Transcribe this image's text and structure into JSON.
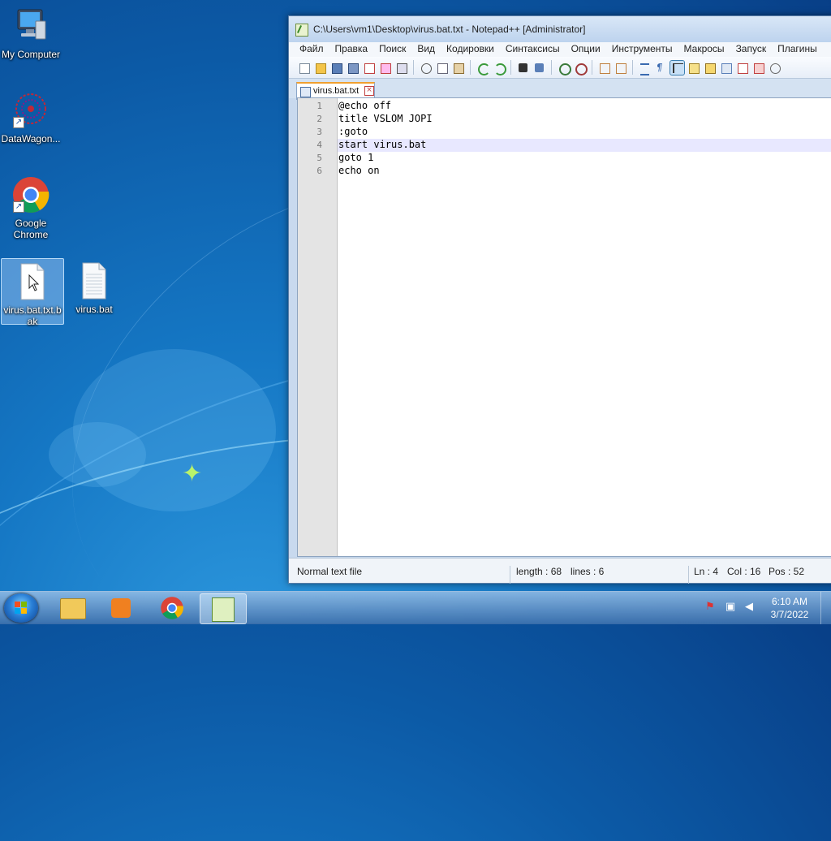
{
  "desktop": {
    "icons": [
      {
        "label": "My Computer",
        "icon": "computer-icon"
      },
      {
        "label": "DataWagon...",
        "icon": "datawagon-icon",
        "shortcut": true
      },
      {
        "label": "Google Chrome",
        "icon": "chrome-icon",
        "shortcut": true
      },
      {
        "label": "virus.bat.txt.bak",
        "icon": "text-file-icon",
        "selected": true
      },
      {
        "label": "virus.bat",
        "icon": "batch-file-icon"
      }
    ]
  },
  "window": {
    "title": "C:\\Users\\vm1\\Desktop\\virus.bat.txt - Notepad++ [Administrator]",
    "menu": [
      "Файл",
      "Правка",
      "Поиск",
      "Вид",
      "Кодировки",
      "Синтаксисы",
      "Опции",
      "Инструменты",
      "Макросы",
      "Запуск",
      "Плагины"
    ],
    "tab": {
      "label": "virus.bat.txt"
    },
    "lines": [
      {
        "num": "1",
        "text": "@echo off"
      },
      {
        "num": "2",
        "text": "title VSLOM JOPI"
      },
      {
        "num": "3",
        "text": ":goto"
      },
      {
        "num": "4",
        "text": "start virus.bat"
      },
      {
        "num": "5",
        "text": "goto 1"
      },
      {
        "num": "6",
        "text": "echo on"
      }
    ],
    "current_line": 4,
    "status": {
      "filetype": "Normal text file",
      "length": "length : 68",
      "lines": "lines : 6",
      "ln": "Ln : 4",
      "col": "Col : 16",
      "pos": "Pos : 52"
    }
  },
  "taskbar": {
    "apps": [
      "explorer-icon",
      "media-player-icon",
      "chrome-icon",
      "notepadpp-icon"
    ],
    "active_app": "notepadpp-icon",
    "clock": {
      "time": "6:10 AM",
      "date": "3/7/2022"
    }
  },
  "colors": {
    "current_line_bg": "#e8e8ff",
    "tab_accent": "#f0a030"
  }
}
